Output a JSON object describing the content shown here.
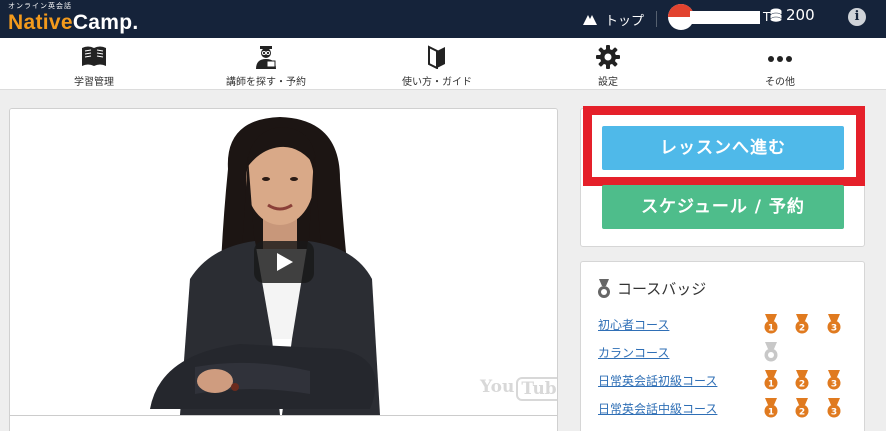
{
  "header": {
    "logo_sub": "オンライン英会話",
    "logo_native": "Native",
    "logo_camp": "Camp.",
    "top_link": "トップ",
    "username_suffix": "T",
    "coins": "200",
    "info_symbol": "i"
  },
  "nav": {
    "items": [
      {
        "label": "学習管理",
        "icon": "book-icon"
      },
      {
        "label": "講師を探す・予約",
        "icon": "teacher-icon"
      },
      {
        "label": "使い方・ガイド",
        "icon": "beginner-mark-icon"
      },
      {
        "label": "設定",
        "icon": "gear-icon"
      },
      {
        "label": "その他",
        "icon": "more-dots-icon"
      }
    ]
  },
  "video": {
    "youtube_mark_you": "You",
    "youtube_mark_tube": "Tube",
    "caption": ""
  },
  "lesson": {
    "go_lesson_label": "レッスンへ進む",
    "schedule_label": "スケジュール / 予約"
  },
  "badges": {
    "title": "コースバッジ",
    "courses": [
      {
        "name": "初心者コース",
        "medals": [
          "1",
          "2",
          "3"
        ],
        "state": "earned"
      },
      {
        "name": "カランコース",
        "medals": [
          ""
        ],
        "state": "silver"
      },
      {
        "name": "日常英会話初級コース",
        "medals": [
          "1",
          "2",
          "3"
        ],
        "state": "earned"
      },
      {
        "name": "日常英会話中級コース",
        "medals": [
          "1",
          "2",
          "3"
        ],
        "state": "earned"
      }
    ]
  },
  "colors": {
    "header_bg": "#15233a",
    "logo_orange": "#f39a1c",
    "lesson_blue": "#4fb9e9",
    "schedule_green": "#4ebd8b",
    "highlight_red": "#e5202a",
    "medal_orange": "#e07a1f",
    "link_blue": "#2f6fb6"
  }
}
